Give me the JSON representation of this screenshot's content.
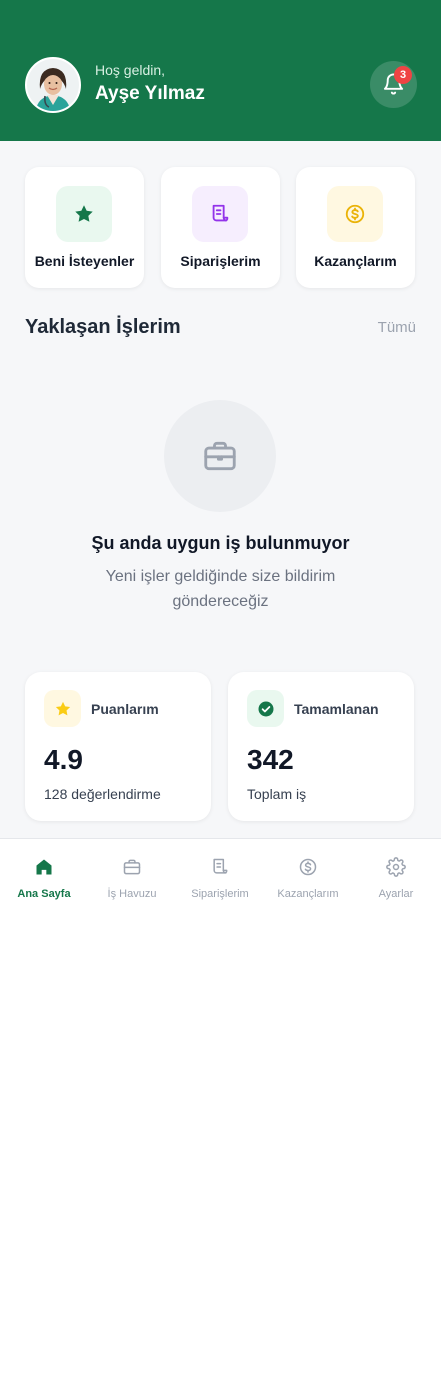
{
  "header": {
    "greeting": "Hoş geldin,",
    "user_name": "Ayşe Yılmaz",
    "notification_count": "3",
    "colors": {
      "primary": "#15774a",
      "badge": "#ef4444"
    }
  },
  "quick_actions": [
    {
      "label": "Beni İsteyenler",
      "icon": "star-icon"
    },
    {
      "label": "Siparişlerim",
      "icon": "receipt-icon"
    },
    {
      "label": "Kazançlarım",
      "icon": "dollar-coin-icon"
    }
  ],
  "upcoming": {
    "title": "Yaklaşan İşlerim",
    "see_all": "Tümü",
    "empty_title": "Şu anda uygun iş bulunmuyor",
    "empty_subtitle": "Yeni işler geldiğinde size bildirim göndereceğiz"
  },
  "stats": [
    {
      "label": "Puanlarım",
      "value": "4.9",
      "sub": "128 değerlendirme",
      "icon": "star-icon"
    },
    {
      "label": "Tamamlanan",
      "value": "342",
      "sub": "Toplam iş",
      "icon": "check-circle-icon"
    }
  ],
  "nav": [
    {
      "label": "Ana Sayfa",
      "icon": "home-icon",
      "active": true
    },
    {
      "label": "İş Havuzu",
      "icon": "briefcase-icon",
      "active": false
    },
    {
      "label": "Siparişlerim",
      "icon": "receipt-icon",
      "active": false
    },
    {
      "label": "Kazançlarım",
      "icon": "dollar-coin-icon",
      "active": false
    },
    {
      "label": "Ayarlar",
      "icon": "gear-icon",
      "active": false
    }
  ]
}
